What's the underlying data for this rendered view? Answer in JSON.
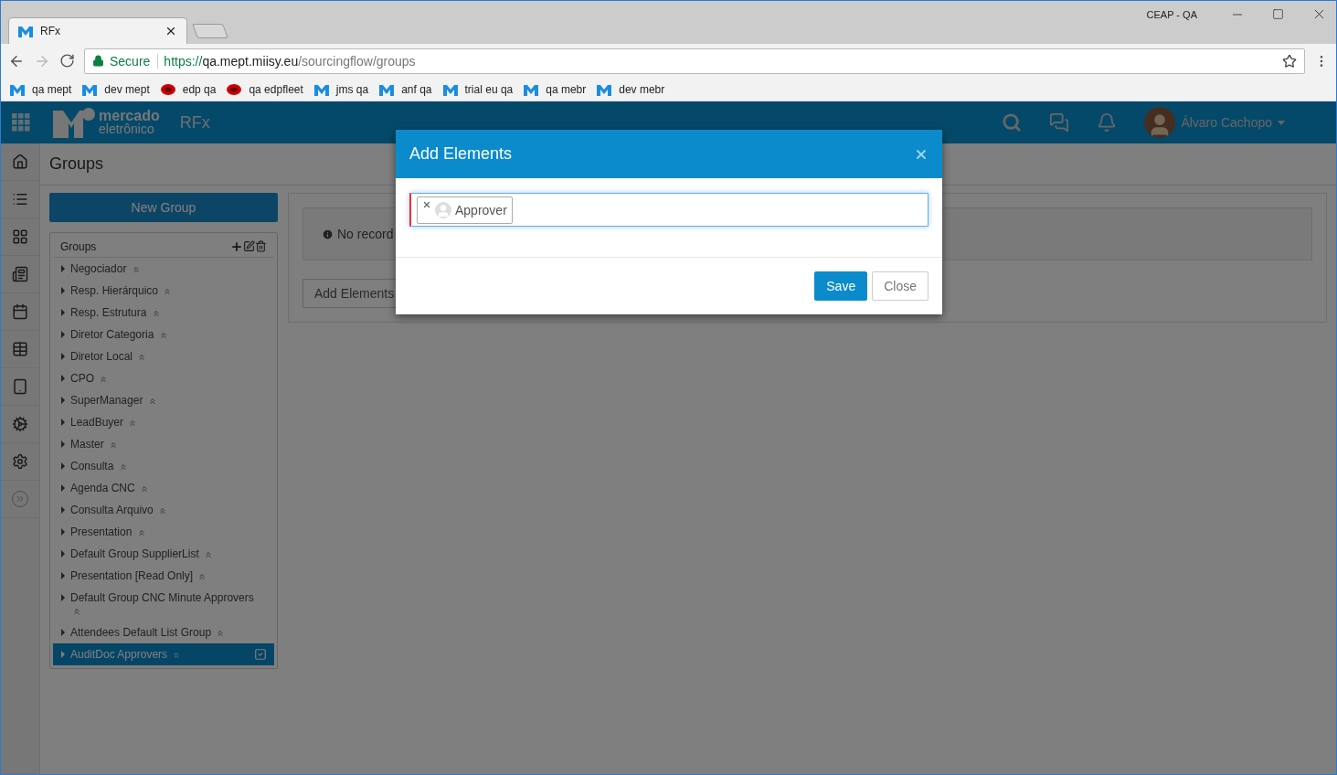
{
  "browser": {
    "window_badge": "CEAP - QA",
    "tab": {
      "title": "RFx"
    },
    "address": {
      "secure_label": "Secure",
      "scheme": "https://",
      "host": "qa.mept.miisy.eu",
      "path": "/sourcingflow/groups"
    },
    "bookmarks": [
      {
        "label": "qa mept",
        "kind": "letter"
      },
      {
        "label": "dev mept",
        "kind": "letter"
      },
      {
        "label": "edp qa",
        "kind": "oval"
      },
      {
        "label": "qa edpfleet",
        "kind": "oval"
      },
      {
        "label": "jms qa",
        "kind": "letter"
      },
      {
        "label": "anf qa",
        "kind": "letter"
      },
      {
        "label": "trial eu qa",
        "kind": "letter"
      },
      {
        "label": "qa mebr",
        "kind": "letter"
      },
      {
        "label": "dev mebr",
        "kind": "letter"
      }
    ]
  },
  "header": {
    "brand_top": "mercado",
    "brand_bottom": "eletrônico",
    "app": "RFx",
    "user": "Álvaro Cachopo"
  },
  "page": {
    "title": "Groups",
    "new_group": "New Group",
    "panel_title": "Groups",
    "groups": [
      {
        "label": "Negociador",
        "selected": false
      },
      {
        "label": "Resp. Hierárquico",
        "selected": false
      },
      {
        "label": "Resp. Estrutura",
        "selected": false
      },
      {
        "label": "Diretor Categoria",
        "selected": false
      },
      {
        "label": "Diretor Local",
        "selected": false
      },
      {
        "label": "CPO",
        "selected": false
      },
      {
        "label": "SuperManager",
        "selected": false
      },
      {
        "label": "LeadBuyer",
        "selected": false
      },
      {
        "label": "Master",
        "selected": false
      },
      {
        "label": "Consulta",
        "selected": false
      },
      {
        "label": "Agenda CNC",
        "selected": false
      },
      {
        "label": "Consulta Arquivo",
        "selected": false
      },
      {
        "label": "Presentation",
        "selected": false
      },
      {
        "label": "Default Group SupplierList",
        "selected": false
      },
      {
        "label": "Presentation [Read Only]",
        "selected": false
      },
      {
        "label": "Default Group CNC Minute Approvers",
        "selected": false
      },
      {
        "label": "Attendees Default List Group",
        "selected": false
      },
      {
        "label": "AuditDoc Approvers",
        "selected": true
      }
    ],
    "no_records": "No record",
    "add_elements": "Add Elements"
  },
  "modal": {
    "title": "Add Elements",
    "tags": [
      {
        "label": "Approver"
      }
    ],
    "buttons": [
      {
        "label": "Save",
        "kind": "primary"
      },
      {
        "label": "Close",
        "kind": "default"
      }
    ]
  }
}
